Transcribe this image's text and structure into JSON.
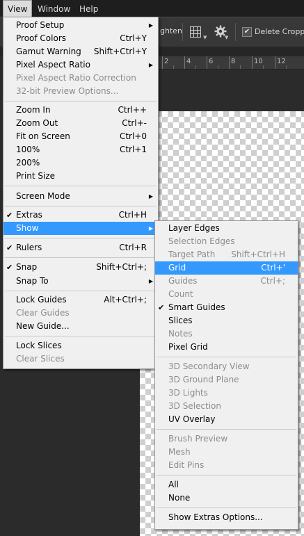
{
  "menubar": {
    "items": [
      "View",
      "Window",
      "Help"
    ],
    "active": "View"
  },
  "optionsbar": {
    "ghost_text": "ghten",
    "delete_cropped_label": "Delete Cropped",
    "delete_cropped_checked": true
  },
  "ruler": {
    "ticks": [
      "2",
      "4",
      "6",
      "8",
      "10",
      "12"
    ]
  },
  "view_menu": {
    "items": [
      {
        "label": "Proof Setup",
        "shortcut": "",
        "submenu": true
      },
      {
        "label": "Proof Colors",
        "shortcut": "Ctrl+Y"
      },
      {
        "label": "Gamut Warning",
        "shortcut": "Shift+Ctrl+Y"
      },
      {
        "label": "Pixel Aspect Ratio",
        "shortcut": "",
        "submenu": true
      },
      {
        "label": "Pixel Aspect Ratio Correction",
        "shortcut": "",
        "disabled": true
      },
      {
        "label": "32-bit Preview Options...",
        "shortcut": "",
        "disabled": true
      },
      {
        "label": "Zoom In",
        "shortcut": "Ctrl++"
      },
      {
        "label": "Zoom Out",
        "shortcut": "Ctrl+-"
      },
      {
        "label": "Fit on Screen",
        "shortcut": "Ctrl+0"
      },
      {
        "label": "100%",
        "shortcut": "Ctrl+1"
      },
      {
        "label": "200%",
        "shortcut": ""
      },
      {
        "label": "Print Size",
        "shortcut": ""
      },
      {
        "label": "Screen Mode",
        "shortcut": "",
        "submenu": true
      },
      {
        "label": "Extras",
        "shortcut": "Ctrl+H",
        "checked": true
      },
      {
        "label": "Show",
        "shortcut": "",
        "submenu": true,
        "highlighted": true
      },
      {
        "label": "Rulers",
        "shortcut": "Ctrl+R",
        "checked": true
      },
      {
        "label": "Snap",
        "shortcut": "Shift+Ctrl+;",
        "checked": true
      },
      {
        "label": "Snap To",
        "shortcut": "",
        "submenu": true
      },
      {
        "label": "Lock Guides",
        "shortcut": "Alt+Ctrl+;"
      },
      {
        "label": "Clear Guides",
        "shortcut": "",
        "disabled": true
      },
      {
        "label": "New Guide...",
        "shortcut": ""
      },
      {
        "label": "Lock Slices",
        "shortcut": ""
      },
      {
        "label": "Clear Slices",
        "shortcut": "",
        "disabled": true
      }
    ]
  },
  "show_menu": {
    "items": [
      {
        "label": "Layer Edges",
        "shortcut": ""
      },
      {
        "label": "Selection Edges",
        "shortcut": "",
        "disabled": true
      },
      {
        "label": "Target Path",
        "shortcut": "Shift+Ctrl+H",
        "disabled": true
      },
      {
        "label": "Grid",
        "shortcut": "Ctrl+'",
        "highlighted": true
      },
      {
        "label": "Guides",
        "shortcut": "Ctrl+;",
        "disabled": true
      },
      {
        "label": "Count",
        "shortcut": "",
        "disabled": true
      },
      {
        "label": "Smart Guides",
        "shortcut": "",
        "checked": true
      },
      {
        "label": "Slices",
        "shortcut": ""
      },
      {
        "label": "Notes",
        "shortcut": "",
        "disabled": true
      },
      {
        "label": "Pixel Grid",
        "shortcut": ""
      },
      {
        "label": "3D Secondary View",
        "shortcut": "",
        "disabled": true
      },
      {
        "label": "3D Ground Plane",
        "shortcut": "",
        "disabled": true
      },
      {
        "label": "3D Lights",
        "shortcut": "",
        "disabled": true
      },
      {
        "label": "3D Selection",
        "shortcut": "",
        "disabled": true
      },
      {
        "label": "UV Overlay",
        "shortcut": ""
      },
      {
        "label": "Brush Preview",
        "shortcut": "",
        "disabled": true
      },
      {
        "label": "Mesh",
        "shortcut": "",
        "disabled": true
      },
      {
        "label": "Edit Pins",
        "shortcut": "",
        "disabled": true
      },
      {
        "label": "All",
        "shortcut": ""
      },
      {
        "label": "None",
        "shortcut": ""
      },
      {
        "label": "Show Extras Options...",
        "shortcut": ""
      }
    ]
  },
  "colors": {
    "highlight": "#3399ff",
    "menu_bg": "#f0f0f0",
    "disabled_text": "#8c8c8c"
  }
}
